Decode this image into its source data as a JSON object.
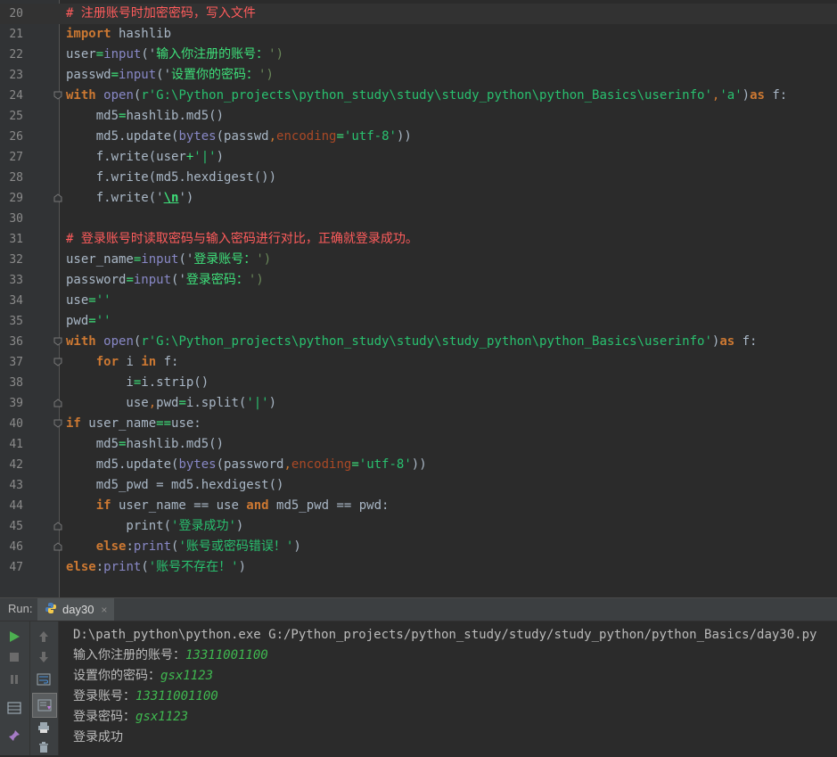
{
  "editor": {
    "lines": [
      {
        "n": "20",
        "segments": [
          {
            "t": "# 注册账号时加密密码，写入文件",
            "c": "cm"
          }
        ]
      },
      {
        "n": "21",
        "segments": [
          {
            "t": "import",
            "c": "kw"
          },
          {
            "t": " hashlib",
            "c": ""
          }
        ]
      },
      {
        "n": "22",
        "segments": [
          {
            "t": "user",
            "c": ""
          },
          {
            "t": "=",
            "c": "strc"
          },
          {
            "t": "input",
            "c": "bi"
          },
          {
            "t": "('",
            "c": ""
          },
          {
            "t": "输入你注册的账号：",
            "c": "strc"
          },
          {
            "t": "')",
            "c": "str"
          }
        ]
      },
      {
        "n": "23",
        "segments": [
          {
            "t": "passwd",
            "c": ""
          },
          {
            "t": "=",
            "c": "strc"
          },
          {
            "t": "input",
            "c": "bi"
          },
          {
            "t": "('",
            "c": ""
          },
          {
            "t": "设置你的密码：",
            "c": "strc"
          },
          {
            "t": "')",
            "c": "str"
          }
        ]
      },
      {
        "n": "24",
        "segments": [
          {
            "t": "with",
            "c": "kw"
          },
          {
            "t": " ",
            "c": ""
          },
          {
            "t": "open",
            "c": "bi"
          },
          {
            "t": "(",
            "c": ""
          },
          {
            "t": "r'G:\\Python_projects\\python_study\\study\\study_python\\python_Basics\\userinfo'",
            "c": "gr"
          },
          {
            "t": ",",
            "c": "pn"
          },
          {
            "t": "'a'",
            "c": "gr"
          },
          {
            "t": ")",
            "c": ""
          },
          {
            "t": "as",
            "c": "kw"
          },
          {
            "t": " f:",
            "c": ""
          }
        ]
      },
      {
        "n": "25",
        "segments": [
          {
            "t": "    md5",
            "c": ""
          },
          {
            "t": "=",
            "c": "strc"
          },
          {
            "t": "hashlib.md5()",
            "c": ""
          }
        ]
      },
      {
        "n": "26",
        "segments": [
          {
            "t": "    md5.update(",
            "c": ""
          },
          {
            "t": "bytes",
            "c": "bi"
          },
          {
            "t": "(passwd",
            "c": ""
          },
          {
            "t": ",",
            "c": "pn"
          },
          {
            "t": "encoding",
            "c": "kwarg"
          },
          {
            "t": "=",
            "c": "strc"
          },
          {
            "t": "'utf-8'",
            "c": "gr"
          },
          {
            "t": "))",
            "c": ""
          }
        ]
      },
      {
        "n": "27",
        "segments": [
          {
            "t": "    f.write(user",
            "c": ""
          },
          {
            "t": "+",
            "c": "strc"
          },
          {
            "t": "'|'",
            "c": "gr"
          },
          {
            "t": ")",
            "c": ""
          }
        ]
      },
      {
        "n": "28",
        "segments": [
          {
            "t": "    f.write(md5.hexdigest())",
            "c": ""
          }
        ]
      },
      {
        "n": "29",
        "segments": [
          {
            "t": "    f.write('",
            "c": ""
          },
          {
            "t": "\\n",
            "c": "esc"
          },
          {
            "t": "')",
            "c": ""
          }
        ]
      },
      {
        "n": "30",
        "segments": []
      },
      {
        "n": "31",
        "segments": [
          {
            "t": "# 登录账号时读取密码与输入密码进行对比，正确就登录成功。",
            "c": "cm"
          }
        ]
      },
      {
        "n": "32",
        "segments": [
          {
            "t": "user_name",
            "c": ""
          },
          {
            "t": "=",
            "c": "strc"
          },
          {
            "t": "input",
            "c": "bi"
          },
          {
            "t": "('",
            "c": ""
          },
          {
            "t": "登录账号：",
            "c": "strc"
          },
          {
            "t": "')",
            "c": "str"
          }
        ]
      },
      {
        "n": "33",
        "segments": [
          {
            "t": "password",
            "c": ""
          },
          {
            "t": "=",
            "c": "strc"
          },
          {
            "t": "input",
            "c": "bi"
          },
          {
            "t": "('",
            "c": ""
          },
          {
            "t": "登录密码：",
            "c": "strc"
          },
          {
            "t": "')",
            "c": "str"
          }
        ]
      },
      {
        "n": "34",
        "segments": [
          {
            "t": "use",
            "c": ""
          },
          {
            "t": "=",
            "c": "strc"
          },
          {
            "t": "''",
            "c": "gr"
          }
        ]
      },
      {
        "n": "35",
        "segments": [
          {
            "t": "pwd",
            "c": ""
          },
          {
            "t": "=",
            "c": "strc"
          },
          {
            "t": "''",
            "c": "gr"
          }
        ]
      },
      {
        "n": "36",
        "segments": [
          {
            "t": "with",
            "c": "kw"
          },
          {
            "t": " ",
            "c": ""
          },
          {
            "t": "open",
            "c": "bi"
          },
          {
            "t": "(",
            "c": ""
          },
          {
            "t": "r'G:\\Python_projects\\python_study\\study\\study_python\\python_Basics\\userinfo'",
            "c": "gr"
          },
          {
            "t": ")",
            "c": ""
          },
          {
            "t": "as",
            "c": "kw"
          },
          {
            "t": " f:",
            "c": ""
          }
        ]
      },
      {
        "n": "37",
        "segments": [
          {
            "t": "    ",
            "c": ""
          },
          {
            "t": "for",
            "c": "kw"
          },
          {
            "t": " i ",
            "c": ""
          },
          {
            "t": "in",
            "c": "kw"
          },
          {
            "t": " f:",
            "c": ""
          }
        ]
      },
      {
        "n": "38",
        "segments": [
          {
            "t": "        i",
            "c": ""
          },
          {
            "t": "=",
            "c": "strc"
          },
          {
            "t": "i.strip()",
            "c": ""
          }
        ]
      },
      {
        "n": "39",
        "segments": [
          {
            "t": "        use",
            "c": ""
          },
          {
            "t": ",",
            "c": "pn"
          },
          {
            "t": "pwd",
            "c": ""
          },
          {
            "t": "=",
            "c": "strc"
          },
          {
            "t": "i.split(",
            "c": ""
          },
          {
            "t": "'|'",
            "c": "gr"
          },
          {
            "t": ")",
            "c": ""
          }
        ]
      },
      {
        "n": "40",
        "segments": [
          {
            "t": "if",
            "c": "kw"
          },
          {
            "t": " user_name",
            "c": ""
          },
          {
            "t": "==",
            "c": "strc"
          },
          {
            "t": "use:",
            "c": ""
          }
        ]
      },
      {
        "n": "41",
        "segments": [
          {
            "t": "    md5",
            "c": ""
          },
          {
            "t": "=",
            "c": "strc"
          },
          {
            "t": "hashlib.md5()",
            "c": ""
          }
        ]
      },
      {
        "n": "42",
        "segments": [
          {
            "t": "    md5.update(",
            "c": ""
          },
          {
            "t": "bytes",
            "c": "bi"
          },
          {
            "t": "(password",
            "c": ""
          },
          {
            "t": ",",
            "c": "pn"
          },
          {
            "t": "encoding",
            "c": "kwarg"
          },
          {
            "t": "=",
            "c": "strc"
          },
          {
            "t": "'utf-8'",
            "c": "gr"
          },
          {
            "t": "))",
            "c": ""
          }
        ]
      },
      {
        "n": "43",
        "segments": [
          {
            "t": "    md5_pwd = md5.hexdigest()",
            "c": ""
          }
        ]
      },
      {
        "n": "44",
        "segments": [
          {
            "t": "    ",
            "c": ""
          },
          {
            "t": "if",
            "c": "kw"
          },
          {
            "t": " user_name == use ",
            "c": ""
          },
          {
            "t": "and",
            "c": "kw"
          },
          {
            "t": " md5_pwd == pwd:",
            "c": ""
          }
        ]
      },
      {
        "n": "45",
        "segments": [
          {
            "t": "        print(",
            "c": ""
          },
          {
            "t": "'登录成功'",
            "c": "gr"
          },
          {
            "t": ")",
            "c": ""
          }
        ]
      },
      {
        "n": "46",
        "segments": [
          {
            "t": "    ",
            "c": ""
          },
          {
            "t": "else",
            "c": "kw"
          },
          {
            "t": ":",
            "c": ""
          },
          {
            "t": "print",
            "c": "bi"
          },
          {
            "t": "(",
            "c": ""
          },
          {
            "t": "'账号或密码错误！'",
            "c": "gr"
          },
          {
            "t": ")",
            "c": ""
          }
        ]
      },
      {
        "n": "47",
        "segments": [
          {
            "t": "else",
            "c": "kw"
          },
          {
            "t": ":",
            "c": ""
          },
          {
            "t": "print",
            "c": "bi"
          },
          {
            "t": "(",
            "c": ""
          },
          {
            "t": "'账号不存在！'",
            "c": "gr"
          },
          {
            "t": ")",
            "c": ""
          }
        ]
      }
    ]
  },
  "run": {
    "label": "Run:",
    "tab_label": "day30",
    "tab_close": "×",
    "console": [
      {
        "text": "D:\\path_python\\python.exe G:/Python_projects/python_study/study/study_python/python_Basics/day30.py",
        "input": ""
      },
      {
        "text": "输入你注册的账号：",
        "input": "13311001100"
      },
      {
        "text": "设置你的密码：",
        "input": "gsx1123"
      },
      {
        "text": "登录账号：",
        "input": "13311001100"
      },
      {
        "text": "登录密码：",
        "input": "gsx1123"
      },
      {
        "text": "登录成功",
        "input": ""
      }
    ]
  },
  "colors": {
    "keyword": "#cc7832",
    "comment": "#ff5c5c",
    "string": "#29c06f",
    "builtin": "#8888c6",
    "console_input": "#3fb950"
  }
}
